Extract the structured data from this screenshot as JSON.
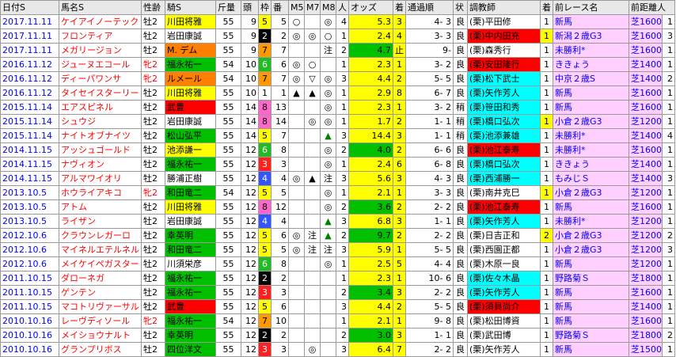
{
  "headers": [
    "日付S",
    "馬名S",
    "性齢",
    "騎S",
    "斤量",
    "頭",
    "枠",
    "番",
    "M5",
    "M7",
    "M8",
    "人",
    "オッズ",
    "着",
    "通過順",
    "状",
    "調教師",
    "着",
    "前レース名",
    "前距離人"
  ],
  "rows": [
    {
      "date": "2017.11.11",
      "horse": "ケイアイノーテック",
      "sex": "牡2",
      "jockey": "川田将雅",
      "jbg": "bgy",
      "weight": "55",
      "heads": "9",
      "waku": "5",
      "ban": "5",
      "m5": "○",
      "m7": "",
      "m8": "◎",
      "pop": "4",
      "odds": "5.3",
      "chaku": "3",
      "tsuka": "4- 3",
      "baba": "良",
      "trainer": "(栗)平田修",
      "tbg": "w",
      "pchaku": "1",
      "pcbg": "w",
      "prace": "新馬",
      "pdist": "芝1600",
      "pnin": "1"
    },
    {
      "date": "2017.11.11",
      "horse": "フロンティア",
      "sex": "牡2",
      "jockey": "岩田康誠",
      "jbg": "w",
      "heads": "9",
      "weight": "55",
      "waku": "2",
      "ban": "2",
      "m5": "◎",
      "m7": "◎",
      "m8": "○",
      "pop": "1",
      "odds": "2.4",
      "chaku": "4",
      "tsuka": "3- 3",
      "baba": "良",
      "trainer": "(栗)中内田充",
      "tbg": "bgr",
      "pchaku": "1",
      "pcbg": "bgy",
      "prace": "新潟２歳G3",
      "pdist": "芝1600",
      "pnin": "3"
    },
    {
      "date": "2017.11.11",
      "horse": "メガリージョン",
      "sex": "牡2",
      "jockey": "M. デム",
      "jbg": "bgo",
      "weight": "55",
      "heads": "9",
      "waku": "7",
      "ban": "7",
      "m5": "",
      "m7": "",
      "m8": "注",
      "pop": "2",
      "odds": "4.7",
      "chaku": "止",
      "tsuka": "9-",
      "baba": "良",
      "trainer": "(栗)森秀行",
      "tbg": "w",
      "pchaku": "1",
      "pcbg": "w",
      "prace": "未勝利*",
      "pdist": "芝1600",
      "pnin": "1"
    },
    {
      "date": "2016.11.12",
      "horse": "ジューヌエコール",
      "sex": "牝2",
      "jockey": "福永祐一",
      "jbg": "bgg",
      "weight": "54",
      "heads": "10",
      "waku": "6",
      "ban": "6",
      "m5": "◎",
      "m7": "○",
      "m8": "",
      "pop": "1",
      "odds": "2.3",
      "chaku": "1",
      "tsuka": "3- 2",
      "baba": "良",
      "trainer": "(栗)安田隆行",
      "tbg": "bgr",
      "pchaku": "1",
      "pcbg": "w",
      "prace": "ききょう",
      "pdist": "芝1400",
      "pnin": "1"
    },
    {
      "date": "2016.11.12",
      "horse": "ディーパワンサ",
      "sex": "牝2",
      "jockey": "ルメール",
      "jbg": "bgo",
      "weight": "54",
      "heads": "10",
      "waku": "7",
      "ban": "7",
      "m5": "◎",
      "m7": "▽",
      "m8": "◎",
      "pop": "3",
      "odds": "4.4",
      "chaku": "2",
      "tsuka": "5- 5",
      "baba": "良",
      "trainer": "(栗)松下武士",
      "tbg": "bgc",
      "pchaku": "1",
      "pcbg": "w",
      "prace": "中京２歳S",
      "pdist": "芝1400",
      "pnin": "2"
    },
    {
      "date": "2016.11.12",
      "horse": "タイセイスターリー",
      "sex": "牡2",
      "jockey": "川田将雅",
      "jbg": "bgy",
      "weight": "55",
      "heads": "10",
      "waku": "1",
      "ban": "1",
      "m5": "▲",
      "m7": "▲",
      "m8": "◎",
      "pop": "1",
      "odds": "2.9",
      "chaku": "8",
      "tsuka": "6- 7",
      "baba": "良",
      "trainer": "(栗)矢作芳人",
      "tbg": "bgc",
      "pchaku": "1",
      "pcbg": "w",
      "prace": "新馬",
      "pdist": "芝1600",
      "pnin": "1"
    },
    {
      "date": "2015.11.14",
      "horse": "エアスピネル",
      "sex": "牡2",
      "jockey": "武豊",
      "jbg": "bgr",
      "weight": "55",
      "heads": "14",
      "waku": "8",
      "ban": "13",
      "m5": "",
      "m7": "",
      "m8": "◎",
      "pop": "1",
      "odds": "2.3",
      "chaku": "1",
      "tsuka": "3- 2",
      "baba": "稍",
      "trainer": "(栗)笹田和秀",
      "tbg": "bgc",
      "pchaku": "1",
      "pcbg": "w",
      "prace": "新馬",
      "pdist": "芝1600",
      "pnin": "1"
    },
    {
      "date": "2015.11.14",
      "horse": "シュウジ",
      "sex": "牡2",
      "jockey": "岩田康誠",
      "jbg": "w",
      "weight": "55",
      "heads": "14",
      "waku": "8",
      "ban": "14",
      "m5": "",
      "m7": "◎",
      "m8": "◎",
      "pop": "1",
      "odds": "1.7",
      "chaku": "2",
      "tsuka": "1- 1",
      "baba": "稍",
      "trainer": "(栗)橋口弘次",
      "tbg": "bgc",
      "pchaku": "1",
      "pcbg": "bgy",
      "prace": "小倉２歳G3",
      "pdist": "芝1200",
      "pnin": "1"
    },
    {
      "date": "2015.11.14",
      "horse": "ナイトオブナイツ",
      "sex": "牡2",
      "jockey": "松山弘平",
      "jbg": "bgg",
      "weight": "55",
      "heads": "14",
      "waku": "5",
      "ban": "7",
      "m5": "",
      "m7": "",
      "m8": "▲",
      "pop": "3",
      "odds": "14.4",
      "chaku": "3",
      "tsuka": "1- 1",
      "baba": "稍",
      "trainer": "(栗)池添兼雄",
      "tbg": "bgc",
      "pchaku": "1",
      "pcbg": "w",
      "prace": "未勝利*",
      "pdist": "芝1400",
      "pnin": "4"
    },
    {
      "date": "2014.11.15",
      "horse": "アッシュゴールド",
      "sex": "牡2",
      "jockey": "池添謙一",
      "jbg": "bgy",
      "weight": "55",
      "heads": "12",
      "waku": "6",
      "ban": "8",
      "m5": "",
      "m7": "",
      "m8": "◎",
      "pop": "2",
      "odds": "4.0",
      "chaku": "2",
      "tsuka": "6- 6",
      "baba": "良",
      "trainer": "(栗)池江泰寿",
      "tbg": "bgr",
      "pchaku": "1",
      "pcbg": "w",
      "prace": "未勝利*",
      "pdist": "芝1600",
      "pnin": "1"
    },
    {
      "date": "2014.11.15",
      "horse": "ナヴィオン",
      "sex": "牡2",
      "jockey": "福永祐一",
      "jbg": "bgg",
      "weight": "55",
      "heads": "12",
      "waku": "3",
      "ban": "3",
      "m5": "",
      "m7": "",
      "m8": "◎",
      "pop": "1",
      "odds": "2.4",
      "chaku": "6",
      "tsuka": "6- 8",
      "baba": "良",
      "trainer": "(栗)橋口弘次",
      "tbg": "bgc",
      "pchaku": "1",
      "pcbg": "w",
      "prace": "ききょう",
      "pdist": "芝1400",
      "pnin": "1"
    },
    {
      "date": "2014.11.15",
      "horse": "アルマワイオリ",
      "sex": "牡2",
      "jockey": "勝浦正樹",
      "jbg": "w",
      "weight": "55",
      "heads": "12",
      "waku": "4",
      "ban": "4",
      "m5": "◎",
      "m7": "▲",
      "m8": "注",
      "pop": "3",
      "odds": "5.6",
      "chaku": "3",
      "tsuka": "4- 3",
      "baba": "良",
      "trainer": "(栗)西浦勝一",
      "tbg": "bgc",
      "pchaku": "1",
      "pcbg": "w",
      "prace": "もみじＳ",
      "pdist": "芝1400",
      "pnin": "3"
    },
    {
      "date": "2013.10.5",
      "horse": "ホウライアキコ",
      "sex": "牝2",
      "jockey": "和田竜二",
      "jbg": "bgg",
      "weight": "54",
      "heads": "12",
      "waku": "5",
      "ban": "5",
      "m5": "",
      "m7": "",
      "m8": "◎",
      "pop": "1",
      "odds": "2.1",
      "chaku": "1",
      "tsuka": "3- 3",
      "baba": "良",
      "trainer": "(栗)南井克巳",
      "tbg": "w",
      "pchaku": "1",
      "pcbg": "bgy",
      "prace": "小倉２歳G3",
      "pdist": "芝1200",
      "pnin": "1"
    },
    {
      "date": "2013.10.5",
      "horse": "アトム",
      "sex": "牡2",
      "jockey": "川田将雅",
      "jbg": "bgy",
      "weight": "55",
      "heads": "12",
      "waku": "8",
      "ban": "12",
      "m5": "",
      "m7": "",
      "m8": "◎",
      "pop": "2",
      "odds": "3.6",
      "chaku": "2",
      "tsuka": "2- 2",
      "baba": "良",
      "trainer": "(栗)池江泰寿",
      "tbg": "bgr",
      "pchaku": "1",
      "pcbg": "w",
      "prace": "新馬",
      "pdist": "芝1600",
      "pnin": "1"
    },
    {
      "date": "2013.10.5",
      "horse": "ライザン",
      "sex": "牡2",
      "jockey": "岩田康誠",
      "jbg": "w",
      "weight": "55",
      "heads": "12",
      "waku": "4",
      "ban": "4",
      "m5": "",
      "m7": "",
      "m8": "▲",
      "pop": "3",
      "odds": "6.8",
      "chaku": "3",
      "tsuka": "1- 1",
      "baba": "良",
      "trainer": "(栗)矢作芳人",
      "tbg": "bgc",
      "pchaku": "1",
      "pcbg": "w",
      "prace": "未勝利*",
      "pdist": "芝1200",
      "pnin": "1"
    },
    {
      "date": "2012.10.6",
      "horse": "クラウンレガーロ",
      "sex": "牡2",
      "jockey": "幸英明",
      "jbg": "bgg",
      "weight": "55",
      "heads": "12",
      "waku": "5",
      "ban": "6",
      "m5": "◎",
      "m7": "注",
      "m8": "▲",
      "pop": "2",
      "odds": "9.7",
      "chaku": "2",
      "tsuka": "2- 2",
      "baba": "良",
      "trainer": "(栗)日吉正和",
      "tbg": "w",
      "pchaku": "2",
      "pcbg": "bgy",
      "prace": "小倉２歳G3",
      "pdist": "芝1200",
      "pnin": "2"
    },
    {
      "date": "2012.10.6",
      "horse": "マイネルエテルネル",
      "sex": "牡2",
      "jockey": "和田竜二",
      "jbg": "bgg",
      "weight": "55",
      "heads": "12",
      "waku": "5",
      "ban": "5",
      "m5": "◎",
      "m7": "注",
      "m8": "注",
      "pop": "3",
      "odds": "5.9",
      "chaku": "1",
      "tsuka": "5- 5",
      "baba": "良",
      "trainer": "(栗)西園正都",
      "tbg": "w",
      "pchaku": "1",
      "pcbg": "w",
      "prace": "小倉２歳G3",
      "pdist": "芝1200",
      "pnin": "3"
    },
    {
      "date": "2012.10.6",
      "horse": "メイケイペガスター",
      "sex": "牡2",
      "jockey": "川須栄彦",
      "jbg": "w",
      "weight": "55",
      "heads": "12",
      "waku": "6",
      "ban": "8",
      "m5": "",
      "m7": "",
      "m8": "◎",
      "pop": "1",
      "odds": "2.5",
      "chaku": "5",
      "tsuka": "4- 4",
      "baba": "良",
      "trainer": "(栗)木原一良",
      "tbg": "w",
      "pchaku": "1",
      "pcbg": "w",
      "prace": "新馬",
      "pdist": "芝1200",
      "pnin": "1"
    },
    {
      "date": "2011.10.15",
      "horse": "ダローネガ",
      "sex": "牡2",
      "jockey": "福永祐一",
      "jbg": "bgg",
      "weight": "55",
      "heads": "12",
      "waku": "2",
      "ban": "2",
      "m5": "",
      "m7": "",
      "m8": "",
      "pop": "1",
      "odds": "2.3",
      "chaku": "1",
      "tsuka": "10- 6",
      "baba": "良",
      "trainer": "(栗)佐々木晶",
      "tbg": "bgc",
      "pchaku": "1",
      "pcbg": "w",
      "prace": "野路菊Ｓ",
      "pdist": "芝1800",
      "pnin": "1"
    },
    {
      "date": "2011.10.15",
      "horse": "ゲンテン",
      "sex": "牡2",
      "jockey": "福永祐一",
      "jbg": "bgg",
      "weight": "55",
      "heads": "12",
      "waku": "3",
      "ban": "3",
      "m5": "",
      "m7": "",
      "m8": "",
      "pop": "2",
      "odds": "3.4",
      "chaku": "3",
      "tsuka": "2- 2",
      "baba": "良",
      "trainer": "(栗)矢作芳人",
      "tbg": "bgc",
      "pchaku": "1",
      "pcbg": "w",
      "prace": "新馬",
      "pdist": "芝1600",
      "pnin": "1"
    },
    {
      "date": "2011.10.15",
      "horse": "マコトリヴァーサル",
      "sex": "牡2",
      "jockey": "武豊",
      "jbg": "bgr",
      "weight": "55",
      "heads": "12",
      "waku": "5",
      "ban": "6",
      "m5": "",
      "m7": "",
      "m8": "",
      "pop": "3",
      "odds": "4.4",
      "chaku": "2",
      "tsuka": "5- 5",
      "baba": "良",
      "trainer": "(栗)須貝尚介",
      "tbg": "bgr",
      "pchaku": "1",
      "pcbg": "w",
      "prace": "新馬",
      "pdist": "芝1400",
      "pnin": "1"
    },
    {
      "date": "2010.10.16",
      "horse": "レーヴディソール",
      "sex": "牝2",
      "jockey": "福永祐一",
      "jbg": "bgg",
      "weight": "54",
      "heads": "12",
      "waku": "7",
      "ban": "10",
      "m5": "",
      "m7": "",
      "m8": "",
      "pop": "1",
      "odds": "2.1",
      "chaku": "1",
      "tsuka": "9- 8",
      "baba": "良",
      "trainer": "(栗)松田博資",
      "tbg": "w",
      "pchaku": "1",
      "pcbg": "w",
      "prace": "新馬",
      "pdist": "芝1600",
      "pnin": "1"
    },
    {
      "date": "2010.10.16",
      "horse": "メイショウナルト",
      "sex": "牡2",
      "jockey": "幸英明",
      "jbg": "bgg",
      "weight": "55",
      "heads": "12",
      "waku": "2",
      "ban": "2",
      "m5": "",
      "m7": "",
      "m8": "",
      "pop": "2",
      "odds": "3.0",
      "chaku": "3",
      "tsuka": "1- 1",
      "baba": "良",
      "trainer": "(栗)武田博",
      "tbg": "w",
      "pchaku": "1",
      "pcbg": "w",
      "prace": "野路菊Ｓ",
      "pdist": "芝1800",
      "pnin": "2"
    },
    {
      "date": "2010.10.16",
      "horse": "グランプリボス",
      "sex": "牡2",
      "jockey": "四位洋文",
      "jbg": "bgg",
      "weight": "55",
      "heads": "12",
      "waku": "3",
      "ban": "3",
      "m5": "",
      "m7": "◎",
      "m8": "",
      "pop": "3",
      "odds": "6.4",
      "chaku": "7",
      "tsuka": "2- 2",
      "baba": "良",
      "trainer": "(栗)矢作芳人",
      "tbg": "w",
      "pchaku": "1",
      "pcbg": "w",
      "prace": "新馬",
      "pdist": "芝1500",
      "pnin": "1"
    }
  ]
}
